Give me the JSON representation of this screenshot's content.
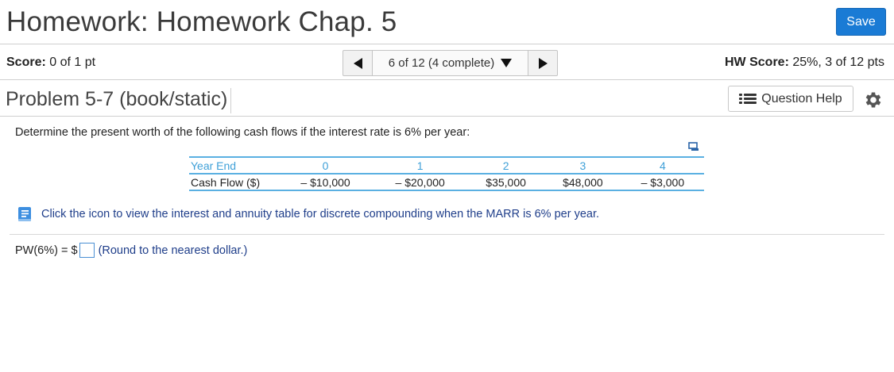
{
  "header": {
    "title": "Homework: Homework Chap. 5",
    "save_label": "Save"
  },
  "score_bar": {
    "score_label": "Score:",
    "score_value": "0 of 1 pt",
    "nav_label": "6 of 12 (4 complete)",
    "hw_score_label": "HW Score:",
    "hw_score_value": "25%, 3 of 12 pts"
  },
  "problem": {
    "title": "Problem 5-7 (book/static)",
    "help_label": "Question Help"
  },
  "question": {
    "text": "Determine the present worth of the following cash flows if the interest rate is 6% per year:",
    "table": {
      "header_label": "Year End",
      "years": [
        "0",
        "1",
        "2",
        "3",
        "4"
      ],
      "row_label": "Cash Flow ($)",
      "values": [
        "– $10,000",
        "– $20,000",
        "$35,000",
        "$48,000",
        "– $3,000"
      ]
    },
    "book_link": "Click the icon to view the interest and annuity table for discrete compounding when the MARR is 6% per year."
  },
  "answer": {
    "prefix": "PW(6%) = $",
    "note": "(Round to the nearest dollar.)"
  },
  "colors": {
    "save_button": "#1a7bd5",
    "table_accent": "#3fa0d8",
    "link_text": "#1f3e8a"
  }
}
